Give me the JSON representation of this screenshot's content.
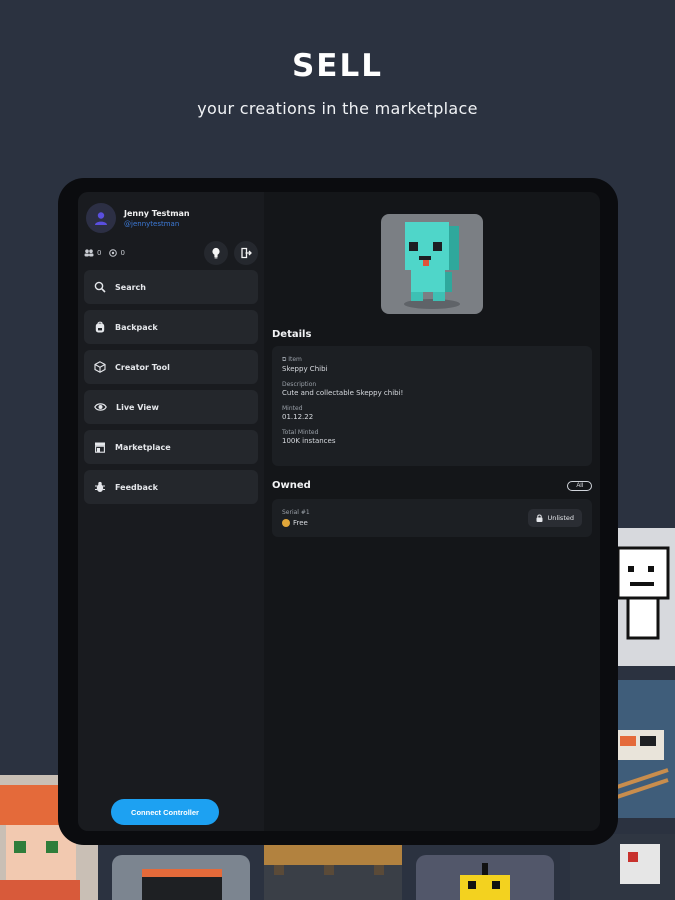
{
  "hero": {
    "title": "SELL",
    "subtitle": "your creations in the marketplace"
  },
  "profile": {
    "name": "Jenny Testman",
    "handle": "@jennytestman",
    "stats": [
      {
        "icon": "people-icon",
        "value": "0"
      },
      {
        "icon": "coin-icon",
        "value": "0"
      }
    ]
  },
  "sidebar": {
    "items": [
      {
        "label": "Search",
        "icon": "search-icon"
      },
      {
        "label": "Backpack",
        "icon": "backpack-icon"
      },
      {
        "label": "Creator Tool",
        "icon": "cube-icon"
      },
      {
        "label": "Live View",
        "icon": "eye-icon"
      },
      {
        "label": "Marketplace",
        "icon": "store-icon"
      },
      {
        "label": "Feedback",
        "icon": "bug-icon"
      }
    ],
    "connect_label": "Connect Controller"
  },
  "item": {
    "details_title": "Details",
    "fields": [
      {
        "label": "Item",
        "value": "Skeppy Chibi"
      },
      {
        "label": "Description",
        "value": "Cute and collectable Skeppy chibi!"
      },
      {
        "label": "Minted",
        "value": "01.12.22"
      },
      {
        "label": "Total Minted",
        "value": "100K instances"
      }
    ],
    "owned_title": "Owned",
    "all_label": "All",
    "owned": [
      {
        "serial": "Serial #1",
        "price": "Free",
        "status": "Unlisted"
      }
    ]
  },
  "colors": {
    "accent": "#1da1f2",
    "background": "#2b3240",
    "coin": "#e0a63a"
  }
}
